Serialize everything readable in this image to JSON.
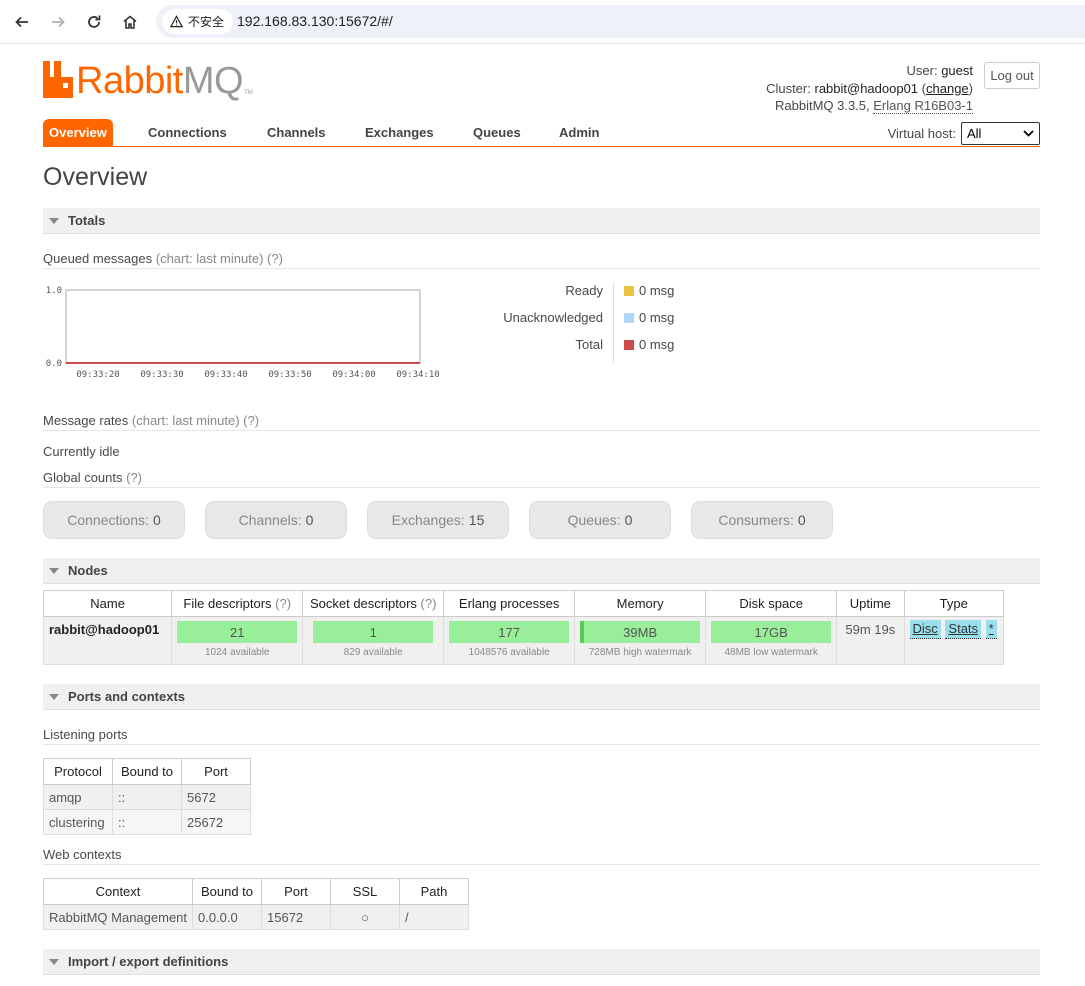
{
  "browser": {
    "security_label": "不安全",
    "url": "192.168.83.130:15672/#/"
  },
  "header": {
    "logo_rabbit": "Rabbit",
    "logo_mq": "MQ",
    "logo_tm": "TM",
    "user_label": "User:",
    "user_value": "guest",
    "cluster_label": "Cluster:",
    "cluster_value": "rabbit@hadoop01",
    "change_link": "change",
    "version": "RabbitMQ 3.3.5,",
    "erlang": "Erlang R16B03-1",
    "logout_label": "Log out"
  },
  "tabs": [
    "Overview",
    "Connections",
    "Channels",
    "Exchanges",
    "Queues",
    "Admin"
  ],
  "vhost": {
    "label": "Virtual host:",
    "selected": "All"
  },
  "page_title": "Overview",
  "sections": {
    "totals": "Totals",
    "nodes": "Nodes",
    "ports": "Ports and contexts",
    "import_export": "Import / export definitions"
  },
  "queued": {
    "title": "Queued messages",
    "chart_note": "(chart: last minute)",
    "help": "(?)"
  },
  "chart_data": {
    "type": "line",
    "x": [
      "09:33:20",
      "09:33:30",
      "09:33:40",
      "09:33:50",
      "09:34:00",
      "09:34:10"
    ],
    "ylim": [
      0.0,
      1.0
    ],
    "ytick_labels": [
      "1.0",
      "0.0"
    ],
    "series": [
      {
        "name": "Ready",
        "values": [
          0,
          0,
          0,
          0,
          0,
          0
        ],
        "color": "#edc240"
      },
      {
        "name": "Unacknowledged",
        "values": [
          0,
          0,
          0,
          0,
          0,
          0
        ],
        "color": "#afd8f8"
      },
      {
        "name": "Total",
        "values": [
          0,
          0,
          0,
          0,
          0,
          0
        ],
        "color": "#cb4b4b"
      }
    ]
  },
  "legend": [
    {
      "label": "Ready",
      "value": "0 msg",
      "color": "#edc240"
    },
    {
      "label": "Unacknowledged",
      "value": "0 msg",
      "color": "#afd8f8"
    },
    {
      "label": "Total",
      "value": "0 msg",
      "color": "#cb4b4b"
    }
  ],
  "rates": {
    "title": "Message rates",
    "chart_note": "(chart: last minute)",
    "help": "(?)",
    "status": "Currently idle"
  },
  "global_counts": {
    "title": "Global counts",
    "help": "(?)",
    "items": [
      {
        "label": "Connections:",
        "value": "0"
      },
      {
        "label": "Channels:",
        "value": "0"
      },
      {
        "label": "Exchanges:",
        "value": "15"
      },
      {
        "label": "Queues:",
        "value": "0"
      },
      {
        "label": "Consumers:",
        "value": "0"
      }
    ]
  },
  "nodes": {
    "headers": {
      "name": "Name",
      "fd": "File descriptors",
      "fd_help": "(?)",
      "sd": "Socket descriptors",
      "sd_help": "(?)",
      "erl": "Erlang processes",
      "mem": "Memory",
      "disk": "Disk space",
      "uptime": "Uptime",
      "type": "Type"
    },
    "row": {
      "name": "rabbit@hadoop01",
      "fd": "21",
      "fd_note": "1024 available",
      "sd": "1",
      "sd_note": "829 available",
      "erl": "177",
      "erl_note": "1048576 available",
      "mem": "39MB",
      "mem_note": "728MB high watermark",
      "disk": "17GB",
      "disk_note": "48MB low watermark",
      "uptime": "59m 19s",
      "type_disc": "Disc",
      "type_stats": "Stats",
      "type_star": "*"
    }
  },
  "listening_ports": {
    "title": "Listening ports",
    "headers": [
      "Protocol",
      "Bound to",
      "Port"
    ],
    "rows": [
      [
        "amqp",
        "::",
        "5672"
      ],
      [
        "clustering",
        "::",
        "25672"
      ]
    ]
  },
  "web_contexts": {
    "title": "Web contexts",
    "headers": [
      "Context",
      "Bound to",
      "Port",
      "SSL",
      "Path"
    ],
    "rows": [
      [
        "RabbitMQ Management",
        "0.0.0.0",
        "15672",
        "○",
        "/"
      ]
    ]
  }
}
